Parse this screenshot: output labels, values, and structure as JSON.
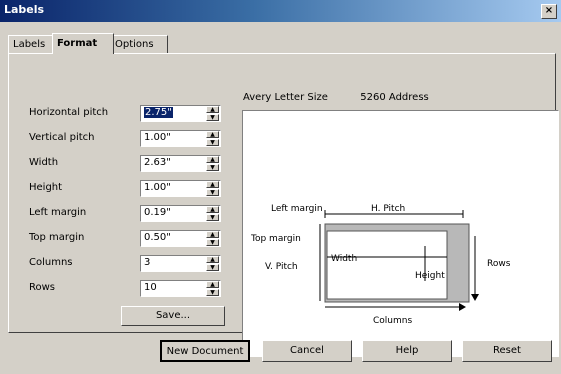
{
  "window": {
    "title": "Labels",
    "close_glyph": "×"
  },
  "tabs": [
    {
      "label": "Labels",
      "active": false
    },
    {
      "label": "Format",
      "active": true
    },
    {
      "label": "Options",
      "active": false
    }
  ],
  "fields": [
    {
      "label": "Horizontal pitch",
      "value": "2.75\"",
      "selected": true
    },
    {
      "label": "Vertical pitch",
      "value": "1.00\"",
      "selected": false
    },
    {
      "label": "Width",
      "value": "2.63\"",
      "selected": false
    },
    {
      "label": "Height",
      "value": "1.00\"",
      "selected": false
    },
    {
      "label": "Left margin",
      "value": "0.19\"",
      "selected": false
    },
    {
      "label": "Top margin",
      "value": "0.50\"",
      "selected": false
    },
    {
      "label": "Columns",
      "value": "3",
      "selected": false
    },
    {
      "label": "Rows",
      "value": "10",
      "selected": false
    }
  ],
  "save_button": "Save...",
  "preview": {
    "brand": "Avery Letter Size",
    "type": "5260 Address",
    "diagram": {
      "left_margin": "Left margin",
      "h_pitch": "H. Pitch",
      "top_margin": "Top margin",
      "v_pitch": "V. Pitch",
      "width": "Width",
      "height": "Height",
      "rows": "Rows",
      "columns": "Columns"
    }
  },
  "buttons": {
    "new_document": "New Document",
    "cancel": "Cancel",
    "help": "Help",
    "reset": "Reset"
  }
}
